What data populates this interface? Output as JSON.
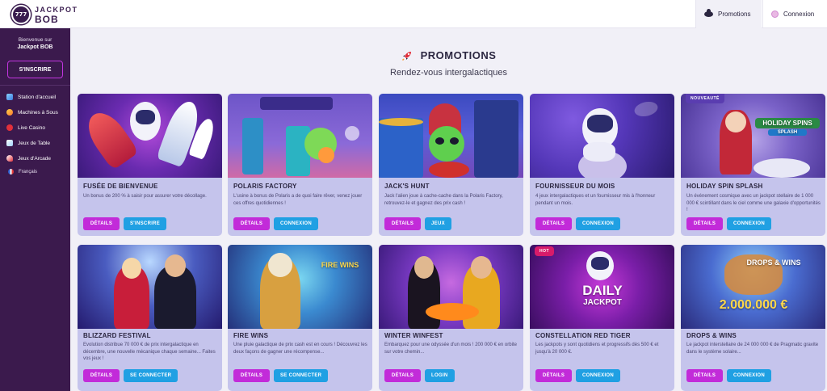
{
  "header": {
    "logo": {
      "badge": "777",
      "line1": "JACKPOT",
      "line2": "BOB"
    },
    "tabs": [
      {
        "label": "Promotions",
        "icon": "ufo-icon",
        "active": true
      },
      {
        "label": "Connexion",
        "icon": "planet-icon",
        "active": false
      }
    ]
  },
  "sidebar": {
    "welcome_line1": "Bienvenue sur",
    "welcome_line2": "Jackpot BOB",
    "signup_label": "S'INSCRIRE",
    "items": [
      {
        "label": "Station d'accueil",
        "icon": "space-station-icon"
      },
      {
        "label": "Machines à Sous",
        "icon": "slot-machine-icon"
      },
      {
        "label": "Live Casino",
        "icon": "live-casino-icon"
      },
      {
        "label": "Jeux de Table",
        "icon": "table-games-icon"
      },
      {
        "label": "Jeux d'Arcade",
        "icon": "arcade-icon"
      }
    ],
    "language": "Français"
  },
  "main": {
    "title": "PROMOTIONS",
    "subtitle": "Rendez-vous intergalactiques"
  },
  "buttons": {
    "details": "DÉTAILS"
  },
  "cards": [
    {
      "title": "FUSÉE DE BIENVENUE",
      "desc": "Un bonus de 200 % à saisir pour assurer votre décollage.",
      "action": "S'INSCRIRE",
      "badge": ""
    },
    {
      "title": "POLARIS FACTORY",
      "desc": "L'usine à bonus de Polaris a de quoi faire rêver, venez jouer ces offres quotidiennes !",
      "action": "CONNEXION",
      "badge": ""
    },
    {
      "title": "JACK'S HUNT",
      "desc": "Jack l'alien joue à cache-cache dans la Polaris Factory, retrouvez-le et gagnez des prix cash !",
      "action": "JEUX",
      "badge": ""
    },
    {
      "title": "FOURNISSEUR DU MOIS",
      "desc": "4 jeux intergalactiques et un fournisseur mis à l'honneur pendant un mois.",
      "action": "CONNEXION",
      "badge": ""
    },
    {
      "title": "HOLIDAY SPIN SPLASH",
      "desc": "Un événement cosmique avec un jackpot stellaire de 1 000 000 € scintillant dans le ciel comme une galaxie d'opportunités !",
      "action": "CONNEXION",
      "badge": "NOUVEAUTÉ",
      "art_text": "HOLIDAY SPINS",
      "art_sub": "SPLASH"
    },
    {
      "title": "BLIZZARD FESTIVAL",
      "desc": "Evolution distribue 70 000 € de prix intergalactique en décembre, une nouvelle mécanique chaque semaine... Faites vos jeux !",
      "action": "SE CONNECTER",
      "badge": ""
    },
    {
      "title": "FIRE WINS",
      "desc": "Une pluie galactique de prix cash est en cours ! Découvrez les deux façons de gagner une récompense...",
      "action": "SE CONNECTER",
      "badge": "",
      "art_text": "FIRE WINS"
    },
    {
      "title": "WINTER WINFEST",
      "desc": "Embarquez pour une odyssée d'un mois ! 200 000 € en orbite sur votre chemin...",
      "action": "LOGIN",
      "badge": ""
    },
    {
      "title": "CONSTELLATION RED TIGER",
      "desc": "Les jackpots y sont quotidiens et progressifs dès 500 € et jusqu'à 20 000 €.",
      "action": "CONNEXION",
      "badge": "HOT",
      "art_text": "DAILY",
      "art_sub": "JACKPOT"
    },
    {
      "title": "DROPS & WINS",
      "desc": "Le jackpot interstellaire de 24 000 000 € de Pragmatic gravite dans le système solaire...",
      "action": "CONNEXION",
      "badge": "",
      "art_text": "DROPS & WINS",
      "art_sub": "2.000.000 €"
    }
  ],
  "colors": {
    "sidebar": "#3b1a4d",
    "details_button": "#c22bd9",
    "action_button": "#20a0e3",
    "card_bg": "#c5c4ec"
  }
}
